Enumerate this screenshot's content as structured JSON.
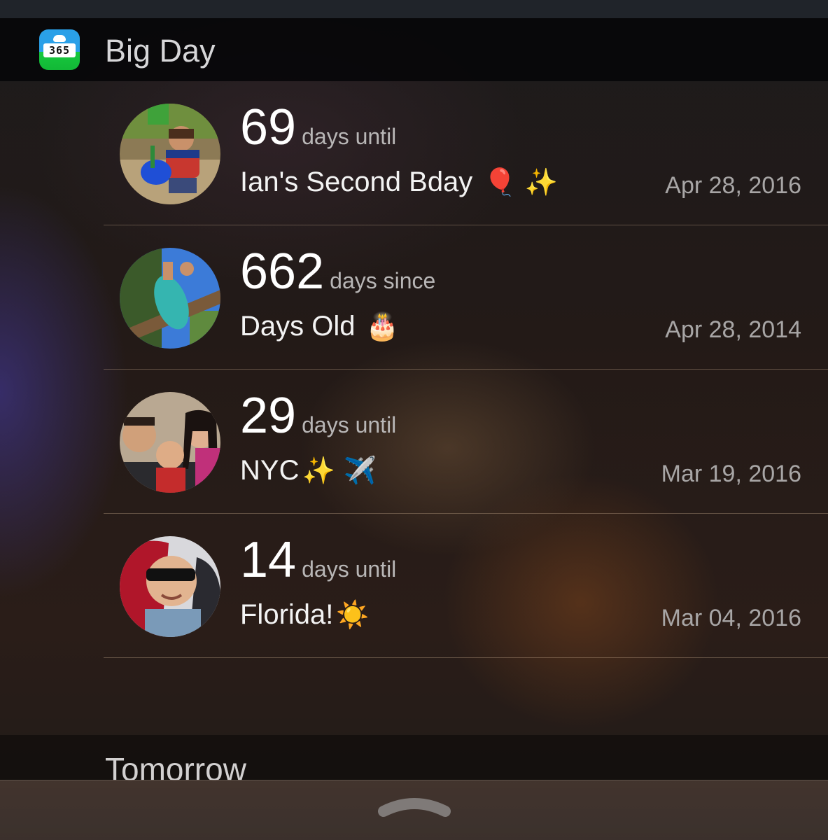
{
  "app": {
    "title": "Big Day",
    "icon_label": "365",
    "icon": "big-day-365-app-icon"
  },
  "events": [
    {
      "count": "69",
      "unit": "days until",
      "title": "Ian's Second Bday",
      "emoji": "🎈 ✨",
      "date": "Apr 28, 2016",
      "photo": "child-playing-sandbox-photo"
    },
    {
      "count": "662",
      "unit": "days since",
      "title": "Days Old",
      "emoji": "🎂",
      "date": "Apr 28, 2014",
      "photo": "child-on-slide-photo"
    },
    {
      "count": "29",
      "unit": "days until",
      "title": "NYC",
      "emoji": "✨ ✈️",
      "date": "Mar 19, 2016",
      "photo": "family-selfie-photo"
    },
    {
      "count": "14",
      "unit": "days until",
      "title": "Florida!",
      "emoji": "☀️",
      "date": "Mar 04, 2016",
      "photo": "child-sunglasses-car-seat-photo"
    }
  ],
  "section": {
    "tomorrow_label": "Tomorrow"
  },
  "colors": {
    "accent_green": "#17c93e",
    "accent_blue": "#2aa0e8",
    "divider": "#b49a84"
  }
}
